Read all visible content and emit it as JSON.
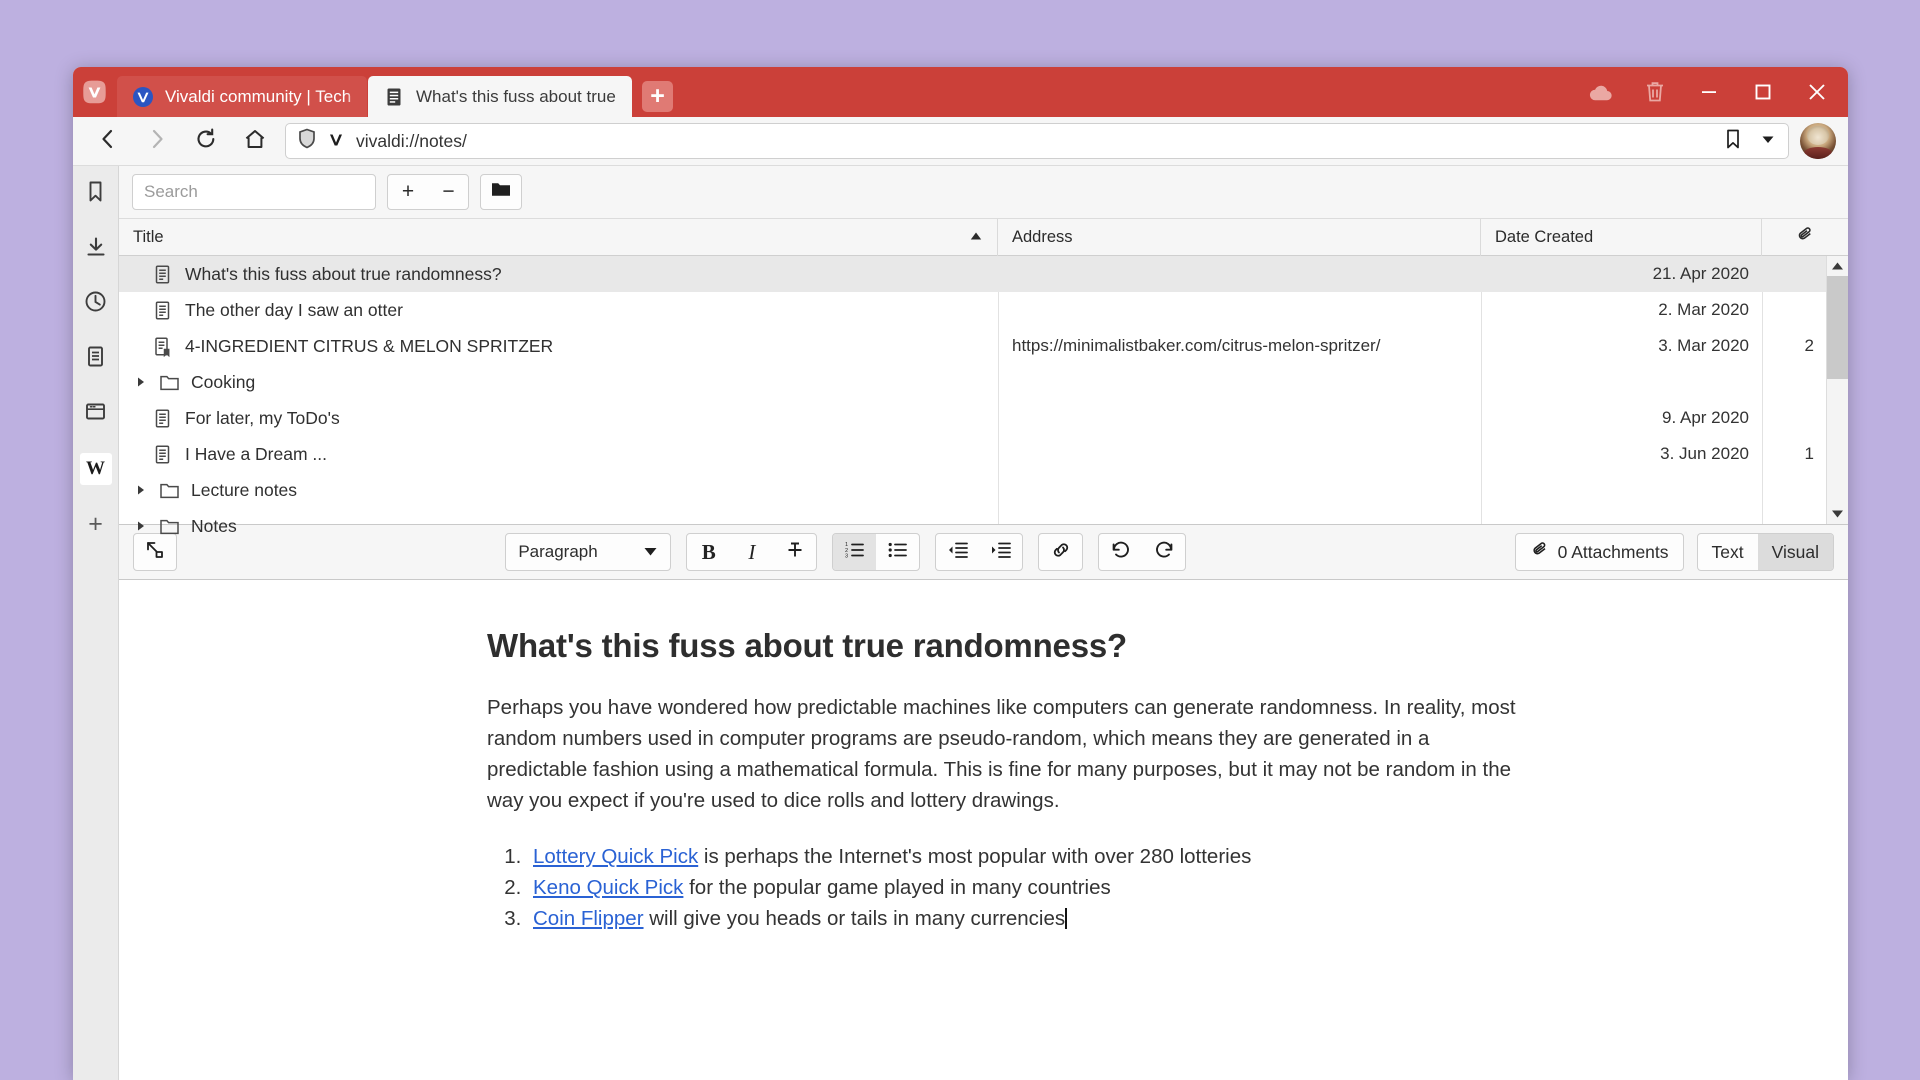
{
  "window": {
    "tabs": [
      {
        "title": "Vivaldi community | Tech fo",
        "favicon": "vivaldi-icon",
        "active": false
      },
      {
        "title": "What's this fuss about true",
        "favicon": "note-icon",
        "active": true
      }
    ],
    "new_tab_label": "+",
    "controls": {
      "sync": "cloud-icon",
      "trash": "trash-icon",
      "minimize": "minimize-icon",
      "maximize": "maximize-icon",
      "close": "close-icon"
    },
    "accent_color": "#cb4039",
    "desktop_background": "#bdb0e0"
  },
  "addressbar": {
    "back": "back-arrow-icon",
    "forward": "forward-arrow-icon",
    "reload": "reload-icon",
    "home": "home-icon",
    "shield": "shield-icon",
    "vivaldi_badge": "vivaldi-v-icon",
    "url": "vivaldi://notes/",
    "bookmark": "bookmark-icon",
    "dropdown": "chevron-down-icon",
    "avatar": "profile-avatar"
  },
  "sidebar": {
    "items": [
      {
        "name": "bookmarks",
        "icon": "bookmark-icon"
      },
      {
        "name": "downloads",
        "icon": "download-icon"
      },
      {
        "name": "history",
        "icon": "clock-icon"
      },
      {
        "name": "notes",
        "icon": "notes-icon"
      },
      {
        "name": "windows",
        "icon": "window-panel-icon"
      },
      {
        "name": "wikipedia",
        "icon": "wikipedia-icon",
        "label": "W"
      },
      {
        "name": "add-panel",
        "icon": "plus-icon",
        "label": "+"
      }
    ]
  },
  "notes_toolbar": {
    "search_placeholder": "Search",
    "search_value": "",
    "add_label": "+",
    "remove_label": "−",
    "folder_icon": "folder-icon"
  },
  "notes_table": {
    "columns": [
      {
        "label": "Title",
        "sort": "ascending"
      },
      {
        "label": "Address"
      },
      {
        "label": "Date Created"
      },
      {
        "label": "",
        "icon": "paperclip-icon"
      }
    ],
    "rows": [
      {
        "title": "What's this fuss about true randomness?",
        "icon": "note-icon",
        "type": "note",
        "address": "",
        "date": "21. Apr 2020",
        "attachments": "",
        "selected": true,
        "indent": true
      },
      {
        "title": "The other day I saw an otter",
        "icon": "note-icon",
        "type": "note",
        "address": "",
        "date": "2. Mar 2020",
        "attachments": "",
        "selected": false,
        "indent": true
      },
      {
        "title": "4-INGREDIENT CITRUS & MELON SPRITZER",
        "icon": "note-attachment-icon",
        "type": "note",
        "address": "https://minimalistbaker.com/citrus-melon-spritzer/",
        "date": "3. Mar 2020",
        "attachments": "2",
        "selected": false,
        "indent": true
      },
      {
        "title": "Cooking",
        "icon": "folder-icon",
        "type": "folder",
        "address": "",
        "date": "",
        "attachments": "",
        "selected": false,
        "indent": false
      },
      {
        "title": "For later, my ToDo's",
        "icon": "note-icon",
        "type": "note",
        "address": "",
        "date": "9. Apr 2020",
        "attachments": "",
        "selected": false,
        "indent": true
      },
      {
        "title": "I Have a Dream ...",
        "icon": "note-icon",
        "type": "note",
        "address": "",
        "date": "3. Jun 2020",
        "attachments": "1",
        "selected": false,
        "indent": true
      },
      {
        "title": "Lecture notes",
        "icon": "folder-icon",
        "type": "folder",
        "address": "",
        "date": "",
        "attachments": "",
        "selected": false,
        "indent": false
      },
      {
        "title": "Notes",
        "icon": "folder-icon",
        "type": "folder",
        "address": "",
        "date": "",
        "attachments": "",
        "selected": false,
        "indent": false
      }
    ]
  },
  "editor_toolbar": {
    "expand": "expand-icon",
    "style_value": "Paragraph",
    "bold": "B",
    "italic": "I",
    "strikethrough": "S",
    "ordered_list": "ordered-list-icon",
    "unordered_list": "bullet-list-icon",
    "outdent": "outdent-icon",
    "indent": "indent-icon",
    "link": "link-icon",
    "undo": "undo-icon",
    "redo": "redo-icon",
    "attachments_label": "0 Attachments",
    "attachments_icon": "paperclip-icon",
    "mode_text": "Text",
    "mode_visual": "Visual",
    "mode_active": "Visual"
  },
  "note": {
    "heading": "What's this fuss about true randomness?",
    "paragraph": "Perhaps you have wondered how predictable machines like computers can generate randomness. In reality, most random numbers used in computer programs are pseudo-random, which means they are generated in a predictable fashion using a mathematical formula. This is fine for many purposes, but it may not be random in the way you expect if you're used to dice rolls and lottery drawings.",
    "list": [
      {
        "link": "Lottery Quick Pick",
        "rest": " is perhaps the Internet's most popular with over 280 lotteries"
      },
      {
        "link": "Keno Quick Pick",
        "rest": " for the popular game played in many countries"
      },
      {
        "link": "Coin Flipper",
        "rest": " will give you heads or tails in many currencies"
      }
    ]
  }
}
